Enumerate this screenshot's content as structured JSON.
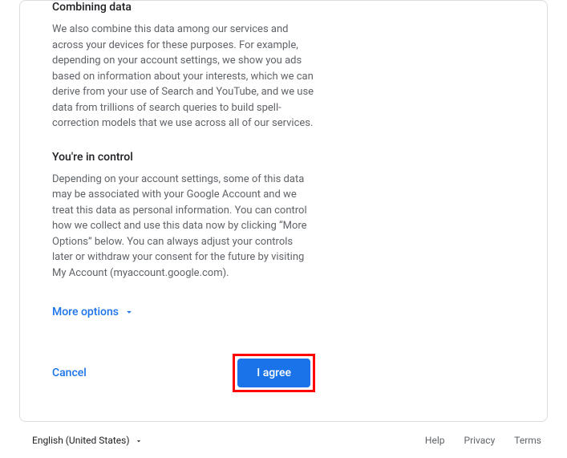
{
  "sections": {
    "combining": {
      "heading": "Combining data",
      "body": "We also combine this data among our services and across your devices for these purposes. For example, depending on your account settings, we show you ads based on information about your interests, which we can derive from your use of Search and YouTube, and we use data from trillions of search queries to build spell-correction models that we use across all of our services."
    },
    "control": {
      "heading": "You're in control",
      "body": "Depending on your account settings, some of this data may be associated with your Google Account and we treat this data as personal information. You can control how we collect and use this data now by clicking “More Options” below. You can always adjust your controls later or withdraw your consent for the future by visiting My Account (myaccount.google.com)."
    }
  },
  "more_options_label": "More options",
  "actions": {
    "cancel": "Cancel",
    "agree": "I agree"
  },
  "footer": {
    "language": "English (United States)",
    "links": {
      "help": "Help",
      "privacy": "Privacy",
      "terms": "Terms"
    }
  },
  "colors": {
    "primary": "#1a73e8",
    "text_primary": "#202124",
    "text_secondary": "#5f6368",
    "border": "#dadce0",
    "highlight": "#ff0000"
  }
}
